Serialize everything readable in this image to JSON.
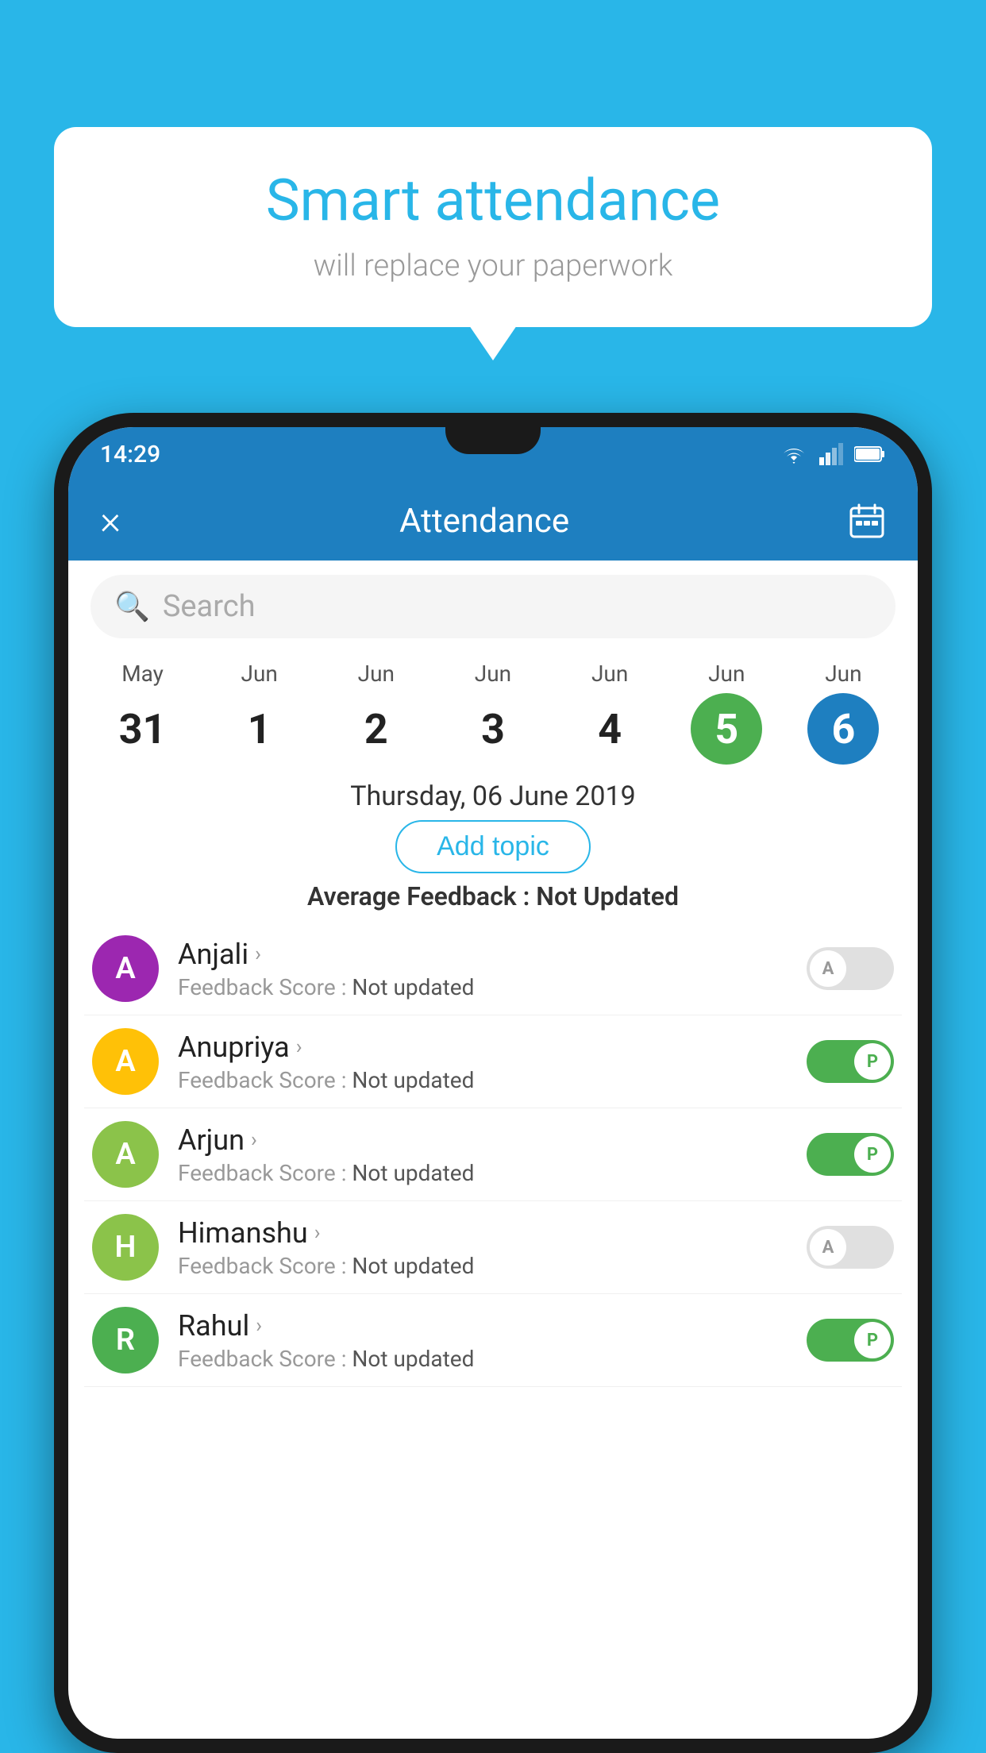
{
  "background_color": "#29b6e8",
  "speech_bubble": {
    "title": "Smart attendance",
    "subtitle": "will replace your paperwork"
  },
  "status_bar": {
    "time": "14:29"
  },
  "header": {
    "title": "Attendance",
    "close_label": "×",
    "calendar_icon": "calendar-icon"
  },
  "search": {
    "placeholder": "Search"
  },
  "calendar": {
    "days": [
      {
        "month": "May",
        "date": "31",
        "style": "normal"
      },
      {
        "month": "Jun",
        "date": "1",
        "style": "normal"
      },
      {
        "month": "Jun",
        "date": "2",
        "style": "normal"
      },
      {
        "month": "Jun",
        "date": "3",
        "style": "normal"
      },
      {
        "month": "Jun",
        "date": "4",
        "style": "normal"
      },
      {
        "month": "Jun",
        "date": "5",
        "style": "today"
      },
      {
        "month": "Jun",
        "date": "6",
        "style": "selected"
      }
    ]
  },
  "selected_date": "Thursday, 06 June 2019",
  "add_topic_label": "Add topic",
  "avg_feedback_label": "Average Feedback :",
  "avg_feedback_value": "Not Updated",
  "students": [
    {
      "name": "Anjali",
      "initial": "A",
      "avatar_color": "#9c27b0",
      "feedback_label": "Feedback Score :",
      "feedback_value": "Not updated",
      "attendance": "absent"
    },
    {
      "name": "Anupriya",
      "initial": "A",
      "avatar_color": "#ffc107",
      "feedback_label": "Feedback Score :",
      "feedback_value": "Not updated",
      "attendance": "present"
    },
    {
      "name": "Arjun",
      "initial": "A",
      "avatar_color": "#8bc34a",
      "feedback_label": "Feedback Score :",
      "feedback_value": "Not updated",
      "attendance": "present"
    },
    {
      "name": "Himanshu",
      "initial": "H",
      "avatar_color": "#8bc34a",
      "feedback_label": "Feedback Score :",
      "feedback_value": "Not updated",
      "attendance": "absent"
    },
    {
      "name": "Rahul",
      "initial": "R",
      "avatar_color": "#4caf50",
      "feedback_label": "Feedback Score :",
      "feedback_value": "Not updated",
      "attendance": "present"
    }
  ],
  "toggle_labels": {
    "absent": "A",
    "present": "P"
  }
}
